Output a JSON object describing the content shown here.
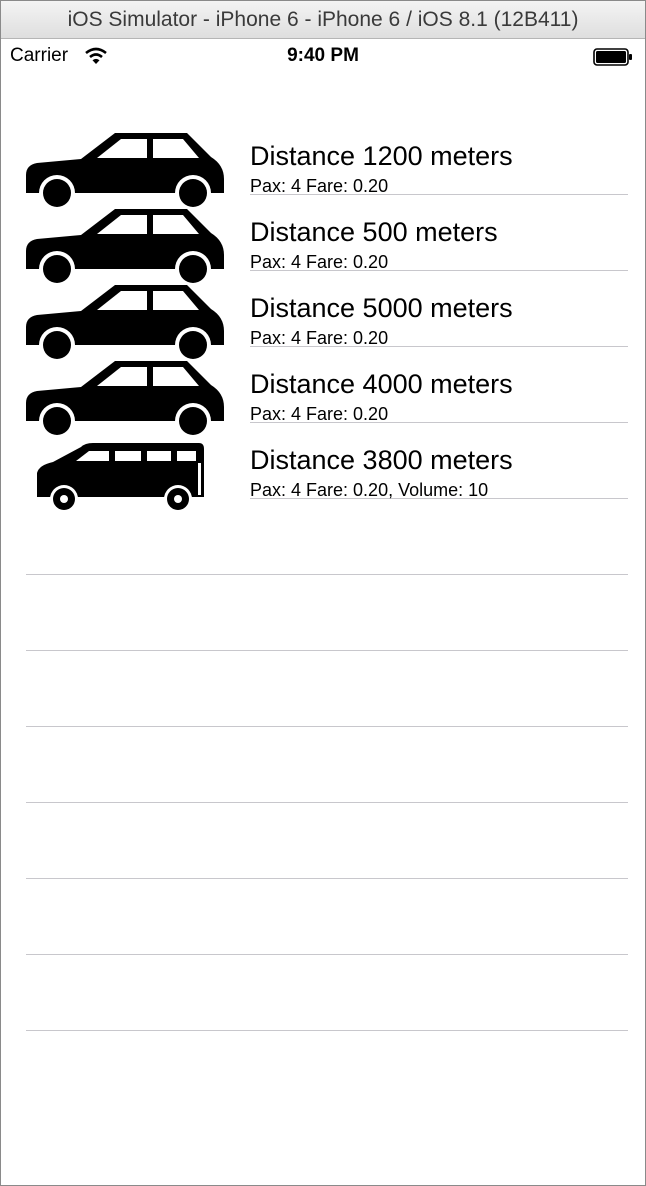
{
  "window": {
    "title": "iOS Simulator - iPhone 6 - iPhone 6 / iOS 8.1 (12B411)"
  },
  "status_bar": {
    "carrier": "Carrier",
    "time": "9:40 PM",
    "wifi_icon": "wifi-icon",
    "battery_icon": "battery-icon"
  },
  "table": {
    "rows": [
      {
        "icon": "car-icon",
        "title": "Distance 1200 meters",
        "subtitle": "Pax: 4 Fare: 0.20"
      },
      {
        "icon": "car-icon",
        "title": "Distance 500 meters",
        "subtitle": "Pax: 4 Fare: 0.20"
      },
      {
        "icon": "car-icon",
        "title": "Distance 5000 meters",
        "subtitle": "Pax: 4 Fare: 0.20"
      },
      {
        "icon": "car-icon",
        "title": "Distance 4000 meters",
        "subtitle": "Pax: 4 Fare: 0.20"
      },
      {
        "icon": "van-icon",
        "title": "Distance 3800 meters",
        "subtitle": "Pax: 4 Fare: 0.20, Volume: 10"
      }
    ]
  }
}
